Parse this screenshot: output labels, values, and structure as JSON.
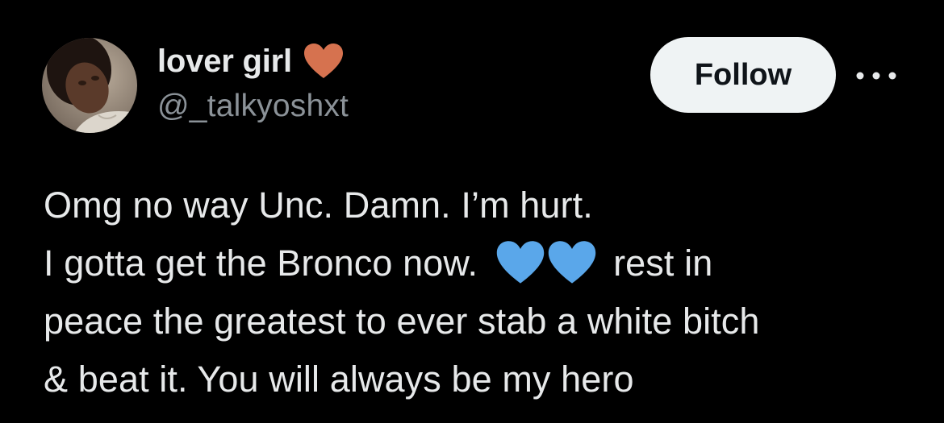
{
  "user": {
    "display_name": "lover girl",
    "badge_icon": "orange-heart-icon",
    "badge_color": "#d6724f",
    "handle": "@_talkyoshxt"
  },
  "actions": {
    "follow_label": "Follow",
    "more_icon": "more-options-icon"
  },
  "tweet": {
    "line1": "Omg no way Unc. Damn. I’m hurt.",
    "line2_before": "I gotta get the Bronco now.",
    "line2_emoji": "blue-heart-icon",
    "line2_emoji_count": 2,
    "line2_emoji_color": "#5aa7ea",
    "line2_after": "rest in",
    "line3": "peace the greatest to ever stab a white bitch",
    "line4": "& beat it. You will always be my hero"
  },
  "colors": {
    "background": "#000000",
    "text_primary": "#e7e9ea",
    "text_secondary": "#8b9298",
    "button_bg": "#eff3f4",
    "button_text": "#0f1419"
  }
}
